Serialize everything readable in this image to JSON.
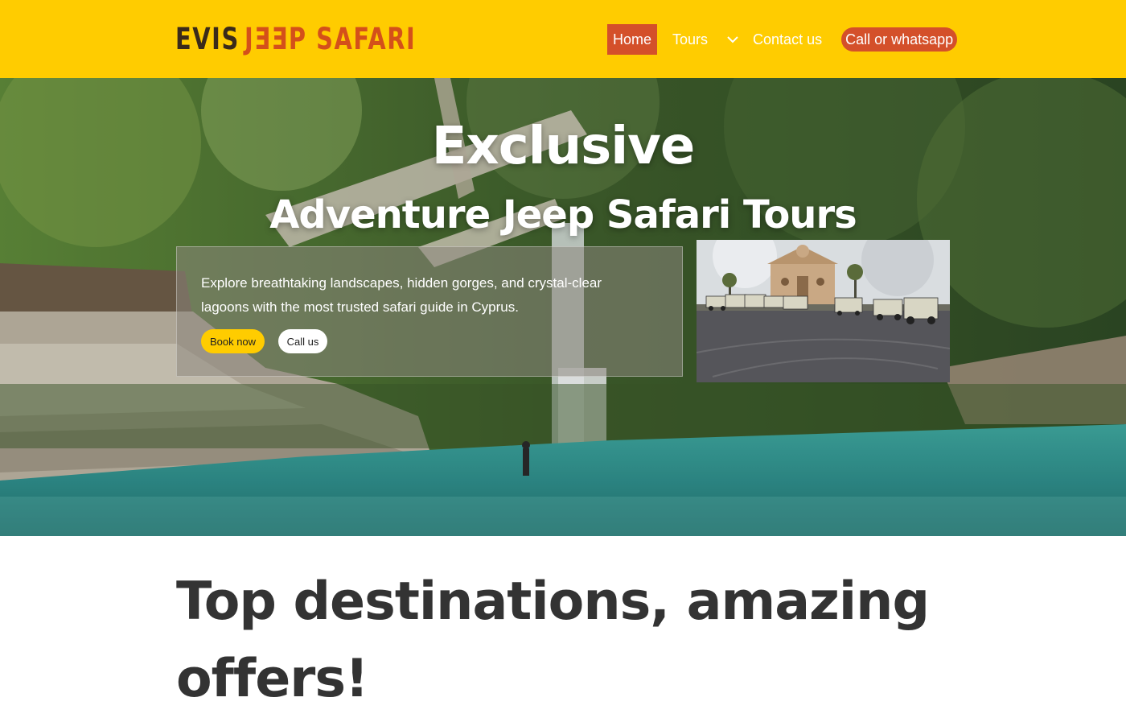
{
  "brand": {
    "logo_word_1": "EVIS",
    "logo_word_2": "JƎƎP SAFARI",
    "color_primary": "#ffcc00",
    "color_accent": "#d4502a"
  },
  "nav": {
    "home": "Home",
    "tours": "Tours",
    "tours_dropdown_icon": "chevron-down-icon",
    "contact": "Contact us",
    "call": "Call or whatsapp"
  },
  "hero": {
    "title": "Exclusive",
    "subtitle": "Adventure Jeep Safari Tours",
    "description": "Explore breathtaking landscapes, hidden gorges, and crystal-clear lagoons with the most trusted safari guide in Cyprus.",
    "book_button": "Book now",
    "call_button": "Call us",
    "background_image": "waterfall-lagoon-photo",
    "side_image": "jeep-fleet-church-photo"
  },
  "section": {
    "heading": "Top destinations, amazing offers!"
  }
}
